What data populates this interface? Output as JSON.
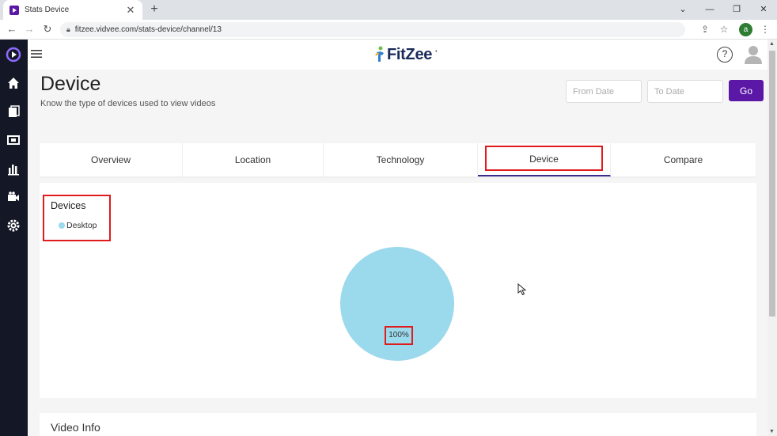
{
  "browser": {
    "tab_title": "Stats Device",
    "tab_close": "✕",
    "new_tab": "+",
    "url": "fitzee.vidvee.com/stats-device/channel/13",
    "profile_initial": "a"
  },
  "header": {
    "brand": "FitZee",
    "brand_mark": "•",
    "help": "?"
  },
  "page": {
    "title": "Device",
    "subtitle": "Know the type of devices used to view videos",
    "from_date_placeholder": "From Date",
    "to_date_placeholder": "To Date",
    "go_label": "Go"
  },
  "tabs": [
    {
      "label": "Overview"
    },
    {
      "label": "Location"
    },
    {
      "label": "Technology"
    },
    {
      "label": "Device"
    },
    {
      "label": "Compare"
    }
  ],
  "active_tab": "Device",
  "chart_data": {
    "type": "pie",
    "legend_title": "Devices",
    "categories": [
      "Desktop"
    ],
    "values": [
      100
    ],
    "labels": [
      "100%"
    ],
    "colors": [
      "#9bd9ec"
    ],
    "legend_position": "top-left"
  },
  "video_info": {
    "title": "Video Info"
  },
  "colors": {
    "accent": "#5b17a6",
    "sidebar": "#141726",
    "highlight": "#e01b1b",
    "pie": "#9bd9ec"
  }
}
